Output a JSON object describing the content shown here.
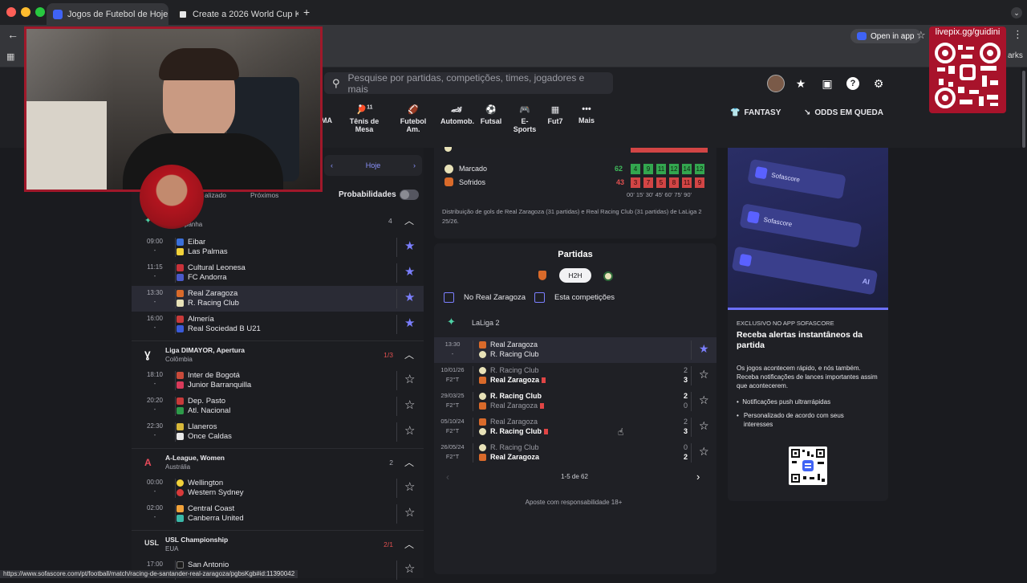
{
  "browser": {
    "tabs": [
      {
        "label": "Jogos de Futebol de Hoje e R",
        "active": true
      },
      {
        "label": "Create a 2026 World Cup Kit:",
        "active": false
      }
    ],
    "new_tab": "+",
    "open_in_app": "Open in app",
    "bookmarks_partial": "arks"
  },
  "stream": {
    "url": "livepix.gg/guidini"
  },
  "header": {
    "search_placeholder": "Pesquise por partidas, competições, times, jogadores e mais",
    "sports": [
      {
        "label": "MA",
        "icon": "mma-icon"
      },
      {
        "label": "Tênis de Mesa",
        "icon": "table-tennis-icon",
        "count": "11"
      },
      {
        "label": "Futebol Am.",
        "icon": "american-football-icon"
      },
      {
        "label": "Automob.",
        "icon": "motorsport-icon"
      },
      {
        "label": "Futsal",
        "icon": "futsal-icon"
      },
      {
        "label": "E-Sports",
        "icon": "esports-icon"
      },
      {
        "label": "Fut7",
        "icon": "fut7-icon"
      },
      {
        "label": "Mais",
        "icon": "more-icon"
      }
    ],
    "fantasy": "FANTASY",
    "odds": "ODDS EM QUEDA"
  },
  "left": {
    "date_label": "Hoje",
    "filters_partial": [
      "alizado",
      "Próximos"
    ],
    "probabilities_label": "Probabilidades",
    "spain_ctry": "panha",
    "spain_count": "4",
    "spain_matches": [
      {
        "time": "09:00",
        "home": "Eibar",
        "away": "Las Palmas",
        "fav": true
      },
      {
        "time": "11:15",
        "home": "Cultural Leonesa",
        "away": "FC Andorra",
        "fav": true
      },
      {
        "time": "13:30",
        "home": "Real Zaragoza",
        "away": "R. Racing Club",
        "fav": true
      },
      {
        "time": "16:00",
        "home": "Almería",
        "away": "Real Sociedad B U21",
        "fav": true
      }
    ],
    "leagues": [
      {
        "name": "Liga DIMAYOR, Apertura",
        "country": "Colômbia",
        "count": "1/3",
        "live": true
      },
      {
        "name": "A-League, Women",
        "country": "Austrália",
        "count": "2",
        "live": false
      },
      {
        "name": "USL Championship",
        "country": "EUA",
        "count": "2/1",
        "live": true
      }
    ],
    "colombia_matches": [
      {
        "time": "18:10",
        "home": "Inter de Bogotá",
        "away": "Junior Barranquilla"
      },
      {
        "time": "20:20",
        "home": "Dep. Pasto",
        "away": "Atl. Nacional"
      },
      {
        "time": "22:30",
        "home": "Llaneros",
        "away": "Once Caldas"
      }
    ],
    "australia_matches": [
      {
        "time": "00:00",
        "home": "Wellington",
        "away": "Western Sydney"
      },
      {
        "time": "02:00",
        "home": "Central Coast",
        "away": "Canberra United"
      }
    ],
    "usa_matches": [
      {
        "time": "17:00",
        "home": "San Antonio"
      }
    ],
    "dash": "-"
  },
  "middle": {
    "goal_dist": {
      "rows": [
        {
          "label": "Marcado",
          "total": "62",
          "values": [
            "4",
            "9",
            "11",
            "12",
            "14",
            "12"
          ],
          "color": "#33a64f"
        },
        {
          "label": "Sofridos",
          "total": "43",
          "values": [
            "3",
            "7",
            "5",
            "8",
            "11",
            "9"
          ],
          "color": "#d24545"
        }
      ],
      "intervals": "00' 15' 30' 45' 60' 75' 90'",
      "note": "Distribuição de gols de Real Zaragoza (31 partidas) e Real Racing Club (31 partidas) de LaLiga 2 25/26."
    },
    "matches_title": "Partidas",
    "h2h_label": "H2H",
    "filter_home": "No Real Zaragoza",
    "filter_comp": "Esta competições",
    "competition": "LaLiga 2",
    "matches": [
      {
        "date": "13:30",
        "sub": "-",
        "home": "Real Zaragoza",
        "away": "R. Racing Club",
        "hs": "",
        "as": "",
        "fav": true,
        "highlight": true
      },
      {
        "date": "10/01/26",
        "sub": "F2°T",
        "home": "R. Racing Club",
        "away": "Real Zaragoza",
        "hs": "2",
        "as": "3",
        "fav": false
      },
      {
        "date": "29/03/25",
        "sub": "F2°T",
        "home": "R. Racing Club",
        "away": "Real Zaragoza",
        "hs": "2",
        "as": "0",
        "fav": false
      },
      {
        "date": "05/10/24",
        "sub": "F2°T",
        "home": "Real Zaragoza",
        "away": "R. Racing Club",
        "hs": "2",
        "as": "3",
        "fav": false
      },
      {
        "date": "26/05/24",
        "sub": "F2°T",
        "home": "R. Racing Club",
        "away": "Real Zaragoza",
        "hs": "0",
        "as": "2",
        "fav": false
      }
    ],
    "pagination": "1-5 de 62",
    "responsible": "Aposte com responsabilidade 18+"
  },
  "ad": {
    "brand": "Sofascore",
    "ai": "AI",
    "kicker": "EXCLUSIVO NO APP SOFASCORE",
    "title": "Receba alertas instantâneos da partida",
    "body": "Os jogos acontecem rápido, e nós também. Receba notificações de lances importantes assim que acontecerem.",
    "bullets": [
      "Notificações push ultrarrápidas",
      "Personalizado de acordo com seus interesses"
    ]
  },
  "status_url": "https://www.sofascore.com/pt/football/match/racing-de-santander-real-zaragoza/pgbsKgb#id:11390042"
}
